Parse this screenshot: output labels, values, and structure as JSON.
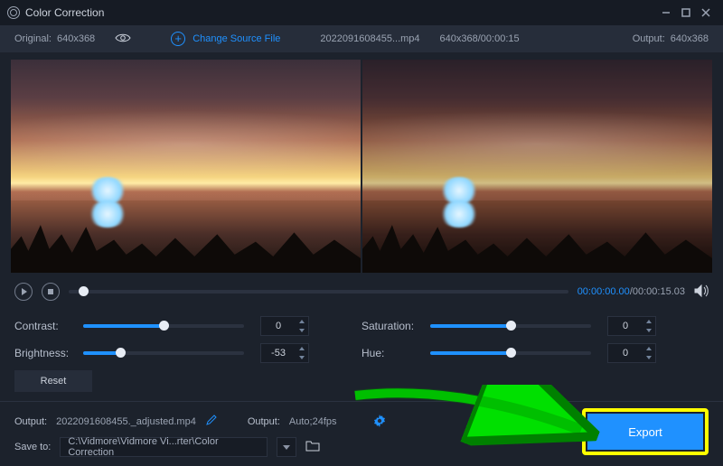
{
  "window": {
    "title": "Color Correction"
  },
  "infobar": {
    "original_label": "Original:",
    "original_dims": "640x368",
    "change_source": "Change Source File",
    "filename": "2022091608455...mp4",
    "dims_time": "640x368/00:00:15",
    "output_label": "Output:",
    "output_dims": "640x368"
  },
  "transport": {
    "current": "00:00:00.00",
    "total": "00:00:15.03"
  },
  "controls": {
    "contrast": {
      "label": "Contrast:",
      "value": "0",
      "fill_pct": 50
    },
    "brightness": {
      "label": "Brightness:",
      "value": "-53",
      "fill_pct": 23
    },
    "saturation": {
      "label": "Saturation:",
      "value": "0",
      "fill_pct": 50
    },
    "hue": {
      "label": "Hue:",
      "value": "0",
      "fill_pct": 50
    },
    "reset": "Reset"
  },
  "output": {
    "file_label": "Output:",
    "file_name": "2022091608455._adjusted.mp4",
    "fmt_label": "Output:",
    "fmt_value": "Auto;24fps",
    "save_label": "Save to:",
    "save_path": "C:\\Vidmore\\Vidmore Vi...rter\\Color Correction"
  },
  "export": {
    "label": "Export"
  }
}
